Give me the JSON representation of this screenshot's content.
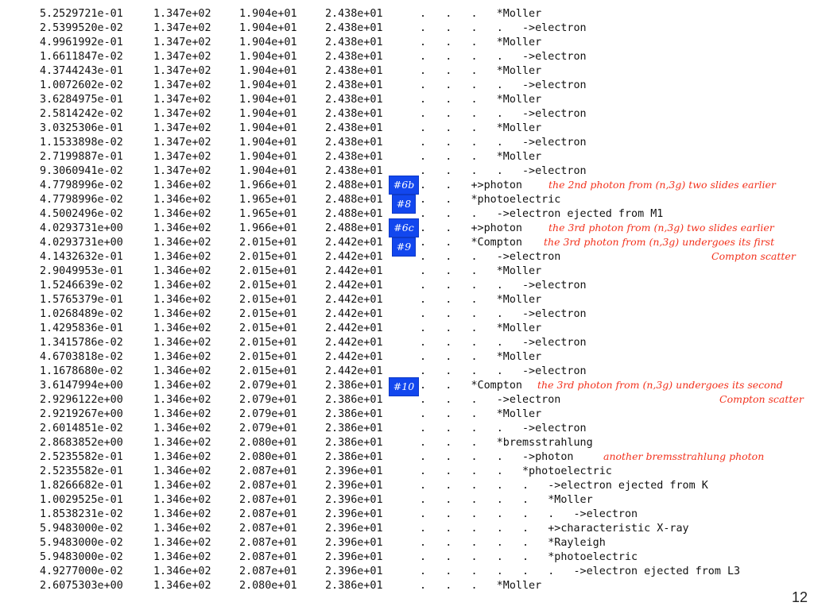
{
  "rows": [
    [
      "5.2529721e-01",
      "1.347e+02",
      "1.904e+01",
      "2.438e+01",
      ".   .   .   *Moller"
    ],
    [
      "2.5399520e-02",
      "1.347e+02",
      "1.904e+01",
      "2.438e+01",
      ".   .   .   .   ->electron"
    ],
    [
      "4.9961992e-01",
      "1.347e+02",
      "1.904e+01",
      "2.438e+01",
      ".   .   .   *Moller"
    ],
    [
      "1.6611847e-02",
      "1.347e+02",
      "1.904e+01",
      "2.438e+01",
      ".   .   .   .   ->electron"
    ],
    [
      "4.3744243e-01",
      "1.347e+02",
      "1.904e+01",
      "2.438e+01",
      ".   .   .   *Moller"
    ],
    [
      "1.0072602e-02",
      "1.347e+02",
      "1.904e+01",
      "2.438e+01",
      ".   .   .   .   ->electron"
    ],
    [
      "3.6284975e-01",
      "1.347e+02",
      "1.904e+01",
      "2.438e+01",
      ".   .   .   *Moller"
    ],
    [
      "2.5814242e-02",
      "1.347e+02",
      "1.904e+01",
      "2.438e+01",
      ".   .   .   .   ->electron"
    ],
    [
      "3.0325306e-01",
      "1.347e+02",
      "1.904e+01",
      "2.438e+01",
      ".   .   .   *Moller"
    ],
    [
      "1.1533898e-02",
      "1.347e+02",
      "1.904e+01",
      "2.438e+01",
      ".   .   .   .   ->electron"
    ],
    [
      "2.7199887e-01",
      "1.347e+02",
      "1.904e+01",
      "2.438e+01",
      ".   .   .   *Moller"
    ],
    [
      "9.3060941e-02",
      "1.347e+02",
      "1.904e+01",
      "2.438e+01",
      ".   .   .   .   ->electron"
    ],
    [
      "4.7798996e-02",
      "1.346e+02",
      "1.966e+01",
      "2.488e+01",
      ".   .   +>photon"
    ],
    [
      "4.7798996e-02",
      "1.346e+02",
      "1.965e+01",
      "2.488e+01",
      ".   .   *photoelectric"
    ],
    [
      "4.5002496e-02",
      "1.346e+02",
      "1.965e+01",
      "2.488e+01",
      ".   .   .   ->electron ejected from M1"
    ],
    [
      "4.0293731e+00",
      "1.346e+02",
      "1.966e+01",
      "2.488e+01",
      ".   .   +>photon"
    ],
    [
      "4.0293731e+00",
      "1.346e+02",
      "2.015e+01",
      "2.442e+01",
      ".   .   *Compton"
    ],
    [
      "4.1432632e-01",
      "1.346e+02",
      "2.015e+01",
      "2.442e+01",
      ".   .   .   ->electron"
    ],
    [
      "2.9049953e-01",
      "1.346e+02",
      "2.015e+01",
      "2.442e+01",
      ".   .   .   *Moller"
    ],
    [
      "1.5246639e-02",
      "1.346e+02",
      "2.015e+01",
      "2.442e+01",
      ".   .   .   .   ->electron"
    ],
    [
      "1.5765379e-01",
      "1.346e+02",
      "2.015e+01",
      "2.442e+01",
      ".   .   .   *Moller"
    ],
    [
      "1.0268489e-02",
      "1.346e+02",
      "2.015e+01",
      "2.442e+01",
      ".   .   .   .   ->electron"
    ],
    [
      "1.4295836e-01",
      "1.346e+02",
      "2.015e+01",
      "2.442e+01",
      ".   .   .   *Moller"
    ],
    [
      "1.3415786e-02",
      "1.346e+02",
      "2.015e+01",
      "2.442e+01",
      ".   .   .   .   ->electron"
    ],
    [
      "4.6703818e-02",
      "1.346e+02",
      "2.015e+01",
      "2.442e+01",
      ".   .   .   *Moller"
    ],
    [
      "1.1678680e-02",
      "1.346e+02",
      "2.015e+01",
      "2.442e+01",
      ".   .   .   .   ->electron"
    ],
    [
      "3.6147994e+00",
      "1.346e+02",
      "2.079e+01",
      "2.386e+01",
      ".   .   *Compton"
    ],
    [
      "2.9296122e+00",
      "1.346e+02",
      "2.079e+01",
      "2.386e+01",
      ".   .   .   ->electron"
    ],
    [
      "2.9219267e+00",
      "1.346e+02",
      "2.079e+01",
      "2.386e+01",
      ".   .   .   *Moller"
    ],
    [
      "2.6014851e-02",
      "1.346e+02",
      "2.079e+01",
      "2.386e+01",
      ".   .   .   .   ->electron"
    ],
    [
      "2.8683852e+00",
      "1.346e+02",
      "2.080e+01",
      "2.386e+01",
      ".   .   .   *bremsstrahlung"
    ],
    [
      "2.5235582e-01",
      "1.346e+02",
      "2.080e+01",
      "2.386e+01",
      ".   .   .   .   ->photon"
    ],
    [
      "2.5235582e-01",
      "1.346e+02",
      "2.087e+01",
      "2.396e+01",
      ".   .   .   .   *photoelectric"
    ],
    [
      "1.8266682e-01",
      "1.346e+02",
      "2.087e+01",
      "2.396e+01",
      ".   .   .   .   .   ->electron ejected from K"
    ],
    [
      "1.0029525e-01",
      "1.346e+02",
      "2.087e+01",
      "2.396e+01",
      ".   .   .   .   .   *Moller"
    ],
    [
      "1.8538231e-02",
      "1.346e+02",
      "2.087e+01",
      "2.396e+01",
      ".   .   .   .   .   .   ->electron"
    ],
    [
      "5.9483000e-02",
      "1.346e+02",
      "2.087e+01",
      "2.396e+01",
      ".   .   .   .   .   +>characteristic X-ray"
    ],
    [
      "5.9483000e-02",
      "1.346e+02",
      "2.087e+01",
      "2.396e+01",
      ".   .   .   .   .   *Rayleigh"
    ],
    [
      "5.9483000e-02",
      "1.346e+02",
      "2.087e+01",
      "2.396e+01",
      ".   .   .   .   .   *photoelectric"
    ],
    [
      "4.9277000e-02",
      "1.346e+02",
      "2.087e+01",
      "2.396e+01",
      ".   .   .   .   .   .   ->electron ejected from L3"
    ],
    [
      "2.6075303e+00",
      "1.346e+02",
      "2.080e+01",
      "2.386e+01",
      ".   .   .   *Moller"
    ]
  ],
  "notes": [
    {
      "text": "the 2nd photon from (n,3g) two slides earlier"
    },
    {
      "text": "the 3rd photon from (n,3g) two slides earlier"
    },
    {
      "text": "the 3rd photon from (n,3g) undergoes its first"
    },
    {
      "text": "Compton scatter"
    },
    {
      "text": "the 3rd photon from (n,3g) undergoes its second"
    },
    {
      "text": "Compton scatter"
    },
    {
      "text": "another bremsstrahlung photon"
    }
  ],
  "badges": [
    "#6b",
    "#8",
    "#6c",
    "#9",
    "#10"
  ],
  "colors": {
    "annotation": "#f2311c",
    "badge": "#1247ee"
  },
  "page_number": "12"
}
